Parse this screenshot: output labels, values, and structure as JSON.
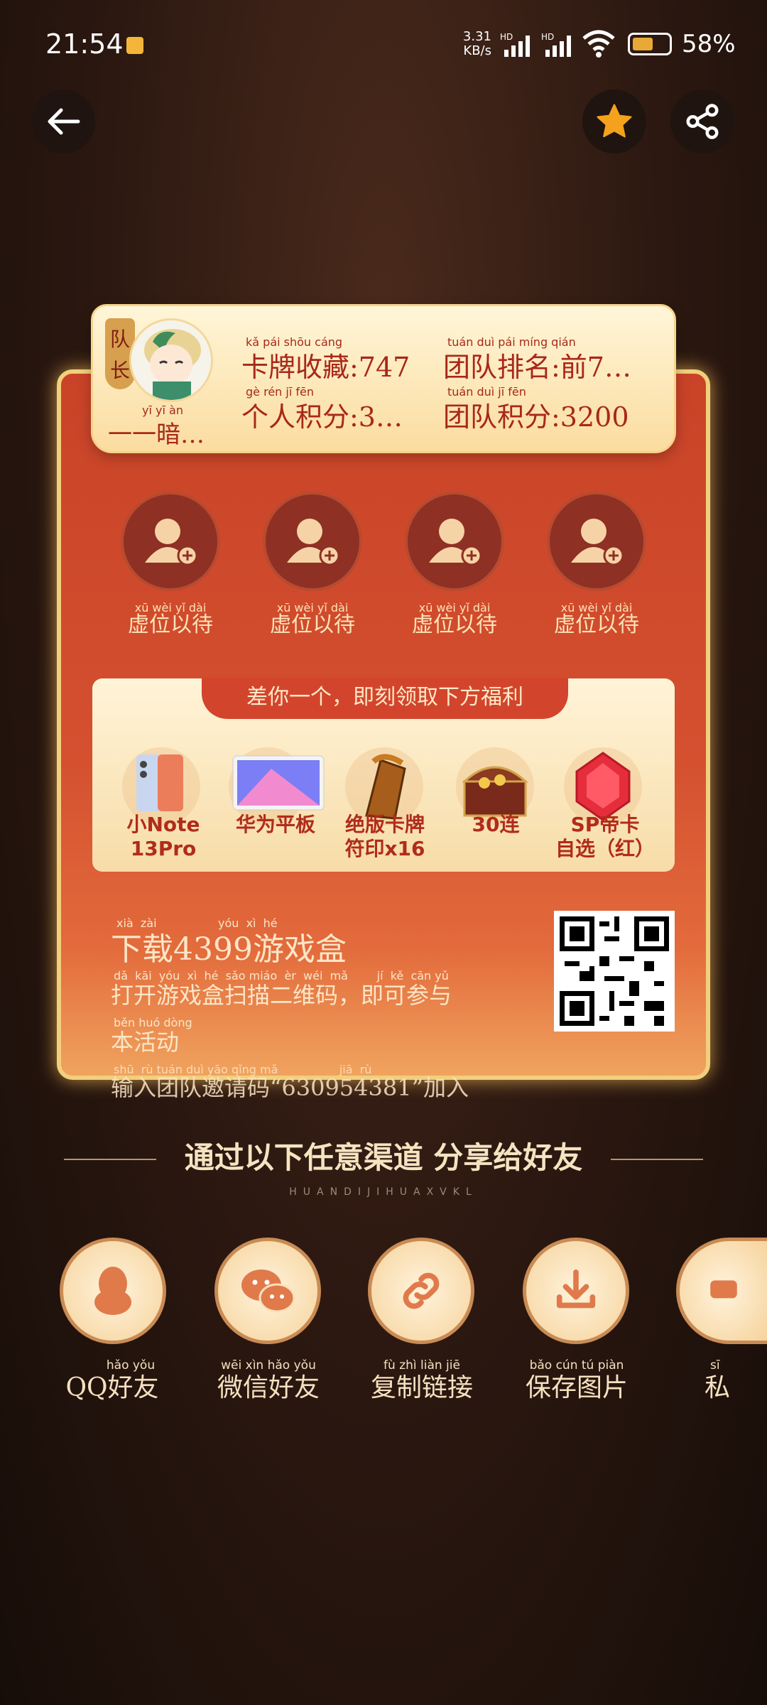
{
  "status_bar": {
    "time": "21:54",
    "rate_top": "3.31",
    "rate_bottom": "KB/s",
    "battery_pct": "58%",
    "battery_level": 0.58
  },
  "header": {
    "back_icon": "arrow-left-icon",
    "favorite_icon": "star-icon",
    "share_icon": "share-icon"
  },
  "team": {
    "captain_tag": "队长",
    "captain_name": "一一暗…",
    "captain_name_pinyin": "yī  yī  àn",
    "stats": [
      {
        "label": "卡牌收藏:747",
        "pinyin": "kǎ  pái  shōu cáng"
      },
      {
        "label": "团队排名:前7…",
        "pinyin": "tuán duì  pái míng  qián"
      },
      {
        "label": "个人积分:3…",
        "pinyin": "gè  rén  jī  fēn"
      },
      {
        "label": "团队积分:3200",
        "pinyin": "tuán duì  jī  fēn"
      }
    ],
    "slots": [
      {
        "label": "虚位以待",
        "pinyin": "xū wèi yǐ dài"
      },
      {
        "label": "虚位以待",
        "pinyin": "xū wèi yǐ dài"
      },
      {
        "label": "虚位以待",
        "pinyin": "xū wèi yǐ dài"
      },
      {
        "label": "虚位以待",
        "pinyin": "xū wèi yǐ dài"
      }
    ]
  },
  "rewards": {
    "header": "差你一个，即刻领取下方福利",
    "items": [
      {
        "line1": "小Note",
        "line2": "13Pro"
      },
      {
        "line1": "华为平板",
        "line2": ""
      },
      {
        "line1": "绝版卡牌",
        "line2": "符印x16"
      },
      {
        "line1": "30连",
        "line2": ""
      },
      {
        "line1": "SP帝卡",
        "line2": "自选（红）"
      }
    ]
  },
  "download": {
    "title": "下载4399游戏盒",
    "title_pinyin": "xià  zài                 yóu  xì  hé",
    "line1": "打开游戏盒扫描二维码，即可参与",
    "line1_pinyin": "dǎ  kāi  yóu  xì  hé  sǎo miáo  èr  wéi  mǎ        jí  kě  cān yǔ",
    "line2": "本活动",
    "line2_pinyin": "běn huó dòng",
    "line3": "输入团队邀请码“630954381”加入",
    "line3_pinyin": "shū  rù tuán duì yāo qǐng mǎ                 jiā  rù"
  },
  "share": {
    "title": "通过以下任意渠道 分享给好友",
    "subtitle": "HUANDIJIHUAXVKL",
    "buttons": [
      {
        "label": "QQ好友",
        "pinyin": "hǎo yǒu",
        "icon": "qq-penguin-icon"
      },
      {
        "label": "微信好友",
        "pinyin": "wēi xìn hǎo yǒu",
        "icon": "wechat-icon"
      },
      {
        "label": "复制链接",
        "pinyin": "fù  zhì  liàn  jiē",
        "icon": "link-icon"
      },
      {
        "label": "保存图片",
        "pinyin": "bǎo cún  tú  piàn",
        "icon": "download-icon"
      },
      {
        "label": "私",
        "pinyin": "sī",
        "icon": "message-icon"
      }
    ]
  },
  "colors": {
    "accent": "#d4502f",
    "gold": "#f2cf7c",
    "text_red": "#a8281a",
    "cream": "#fff4d8"
  }
}
